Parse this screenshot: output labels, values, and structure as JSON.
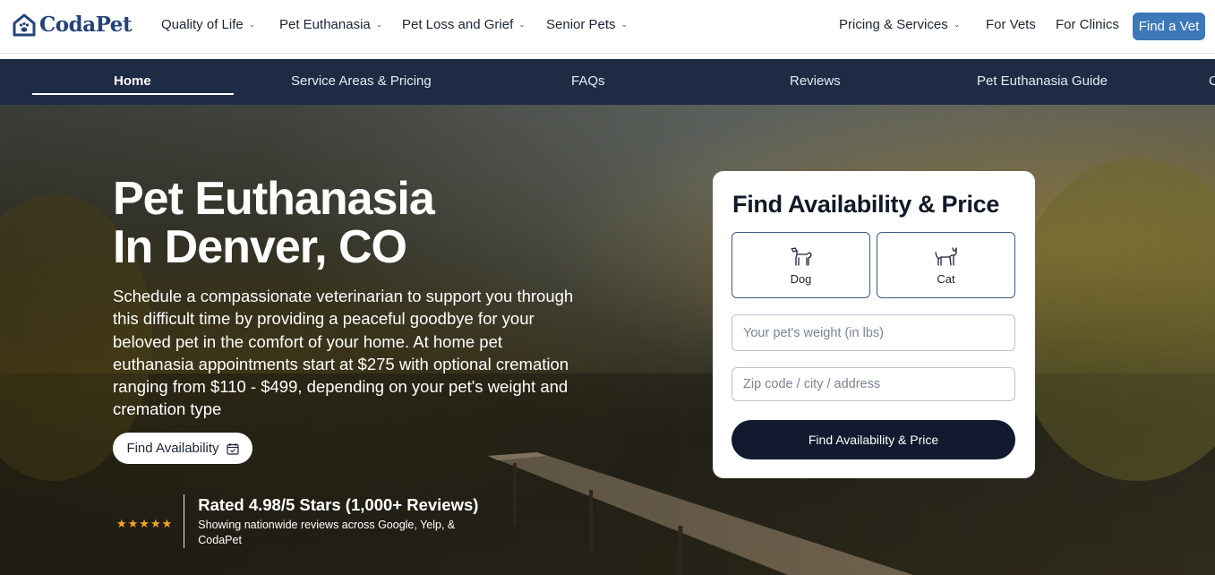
{
  "brand": {
    "name": "CodaPet",
    "accent": "#3d79b8",
    "navy": "#1d2b45"
  },
  "topnav": {
    "items": [
      {
        "label": "Quality of Life",
        "dropdown": true
      },
      {
        "label": "Pet Euthanasia",
        "dropdown": true
      },
      {
        "label": "Pet Loss and Grief",
        "dropdown": true
      },
      {
        "label": "Senior Pets",
        "dropdown": true
      },
      {
        "label": "Pricing & Services",
        "dropdown": true
      },
      {
        "label": "For Vets",
        "dropdown": false
      },
      {
        "label": "For Clinics",
        "dropdown": false
      }
    ],
    "cta_label": "Find a Vet"
  },
  "subnav": {
    "items": [
      {
        "label": "Home",
        "active": true
      },
      {
        "label": "Service Areas & Pricing",
        "active": false
      },
      {
        "label": "FAQs",
        "active": false
      },
      {
        "label": "Reviews",
        "active": false
      },
      {
        "label": "Pet Euthanasia Guide",
        "active": false
      },
      {
        "label": "C",
        "active": false
      }
    ]
  },
  "hero": {
    "title_line1": "Pet Euthanasia",
    "title_line2": "In Denver, CO",
    "description": "Schedule a compassionate veterinarian to support you through this difficult time by providing a peaceful goodbye for your beloved pet in the comfort of your home. At home pet euthanasia appointments start at $275 with optional cremation ranging from $110 - $499, depending on your pet's weight and cremation type",
    "button_label": "Find Availability",
    "rating": {
      "stars": "★★★★★",
      "title": "Rated 4.98/5 Stars (1,000+ Reviews)",
      "subtitle": "Showing nationwide reviews across Google, Yelp, & CodaPet"
    }
  },
  "card": {
    "title": "Find Availability & Price",
    "pets": [
      {
        "label": "Dog",
        "icon": "dog-icon"
      },
      {
        "label": "Cat",
        "icon": "cat-icon"
      }
    ],
    "weight_placeholder": "Your pet's weight (in lbs)",
    "weight_value": "",
    "location_placeholder": "Zip code / city / address",
    "location_value": "",
    "submit_label": "Find Availability & Price"
  }
}
